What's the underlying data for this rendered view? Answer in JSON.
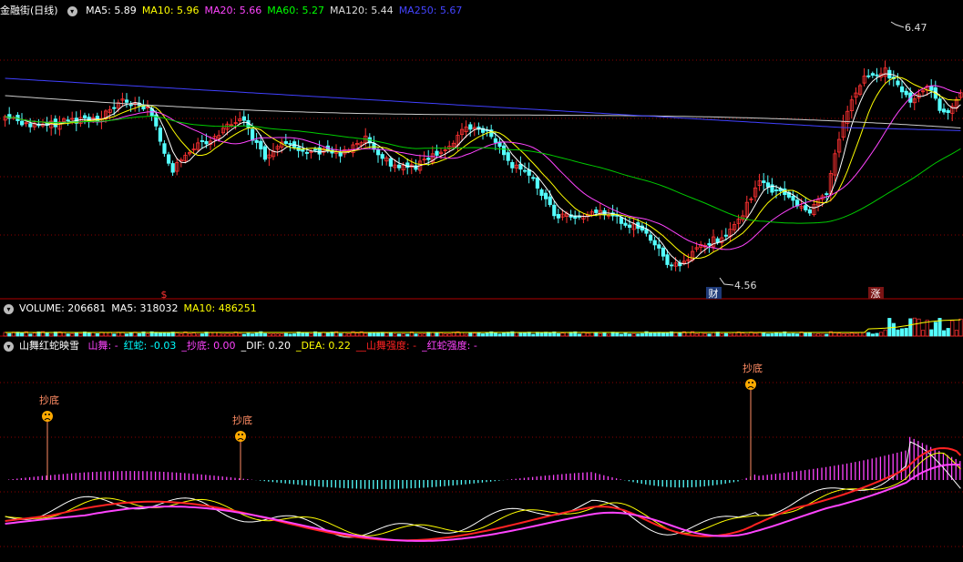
{
  "main_header": {
    "stock": "金融街(日线)",
    "items": [
      {
        "label": "MA5: ",
        "value": "5.89",
        "color": "#ffffff"
      },
      {
        "label": "MA10: ",
        "value": "5.96",
        "color": "#ffff00"
      },
      {
        "label": "MA20: ",
        "value": "5.66",
        "color": "#ff44ff"
      },
      {
        "label": "MA60: ",
        "value": "5.27",
        "color": "#00ff00"
      },
      {
        "label": "MA120: ",
        "value": "5.44",
        "color": "#dddddd"
      },
      {
        "label": "MA250: ",
        "value": "5.67",
        "color": "#4444ff"
      }
    ]
  },
  "volume_header": {
    "items": [
      {
        "label": "VOLUME: ",
        "value": "206681",
        "color": "#ffffff"
      },
      {
        "label": "MA5: ",
        "value": "318032",
        "color": "#ffffff"
      },
      {
        "label": "MA10: ",
        "value": "486251",
        "color": "#ffff00"
      }
    ]
  },
  "indicator_header": {
    "name": "山舞红蛇映雪",
    "items": [
      {
        "label": "山舞: ",
        "value": "-",
        "color": "#ff44ff"
      },
      {
        "label": "红蛇: ",
        "value": "-0.03",
        "color": "#00ffff"
      },
      {
        "label": "_抄底: ",
        "value": "0.00",
        "color": "#ff44ff"
      },
      {
        "label": "_DIF: ",
        "value": "0.20",
        "color": "#ffffff"
      },
      {
        "label": "_DEA: ",
        "value": "0.22",
        "color": "#ffff00"
      },
      {
        "label": "__山舞强度: ",
        "value": "-",
        "color": "#ff2222"
      },
      {
        "label": "_红蛇强度: ",
        "value": "-",
        "color": "#ff44ff"
      }
    ]
  },
  "colors": {
    "up": "#ff3232",
    "down": "#54ffff",
    "grid": "#8b0000",
    "ma5": "#ffffff",
    "ma10": "#ffff00",
    "ma20": "#ff44ff",
    "ma60": "#00cc00",
    "ma120": "#cccccc",
    "ma250": "#4040ff",
    "signal": "#ff8c64",
    "face": "#ffaa00"
  },
  "chart_data": [
    {
      "type": "candlestick",
      "price_max": "6.47",
      "price_min": "4.56",
      "markers": [
        "$",
        "财",
        "涨"
      ]
    },
    {
      "type": "bar",
      "name": "volume"
    },
    {
      "type": "line",
      "name": "indicator",
      "signal_label": "抄底",
      "signals": [
        {
          "label": "抄底"
        },
        {
          "label": "抄底"
        },
        {
          "label": "抄底"
        }
      ]
    }
  ]
}
